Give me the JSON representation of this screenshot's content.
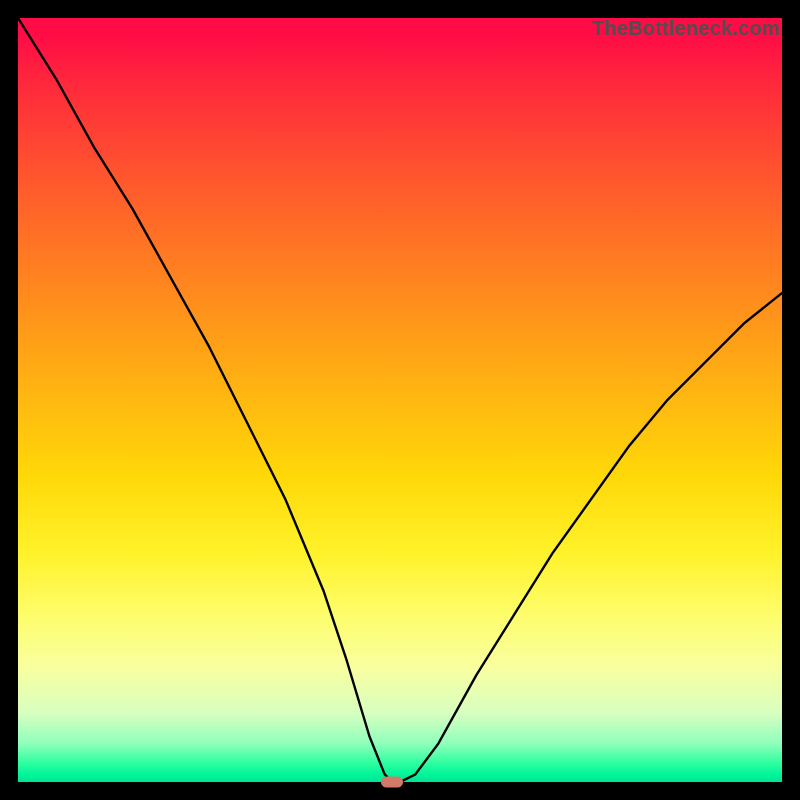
{
  "watermark": "TheBottleneck.com",
  "colors": {
    "frame": "#000000",
    "curve": "#000000",
    "marker": "#d17a6a",
    "gradient_top": "#ff0b46",
    "gradient_bottom": "#00e595"
  },
  "chart_data": {
    "type": "line",
    "title": "",
    "xlabel": "",
    "ylabel": "",
    "xlim": [
      0,
      100
    ],
    "ylim": [
      0,
      100
    ],
    "axes_visible": false,
    "grid": false,
    "legend": false,
    "description": "V-shaped bottleneck curve plotted over a vertical red→yellow→green gradient. High y = bottleneck (red), low y = balanced (green). Minimum (near-zero bottleneck) occurs around x≈49 with a short flat segment; a small rounded marker is drawn at the minimum.",
    "series": [
      {
        "name": "bottleneck-curve",
        "x": [
          0,
          5,
          10,
          15,
          20,
          25,
          30,
          35,
          40,
          43,
          46,
          48,
          49,
          50,
          52,
          55,
          60,
          65,
          70,
          75,
          80,
          85,
          90,
          95,
          100
        ],
        "values": [
          100,
          92,
          83,
          75,
          66,
          57,
          47,
          37,
          25,
          16,
          6,
          1,
          0,
          0,
          1,
          5,
          14,
          22,
          30,
          37,
          44,
          50,
          55,
          60,
          64
        ]
      }
    ],
    "marker": {
      "x": 49,
      "y": 0
    }
  }
}
